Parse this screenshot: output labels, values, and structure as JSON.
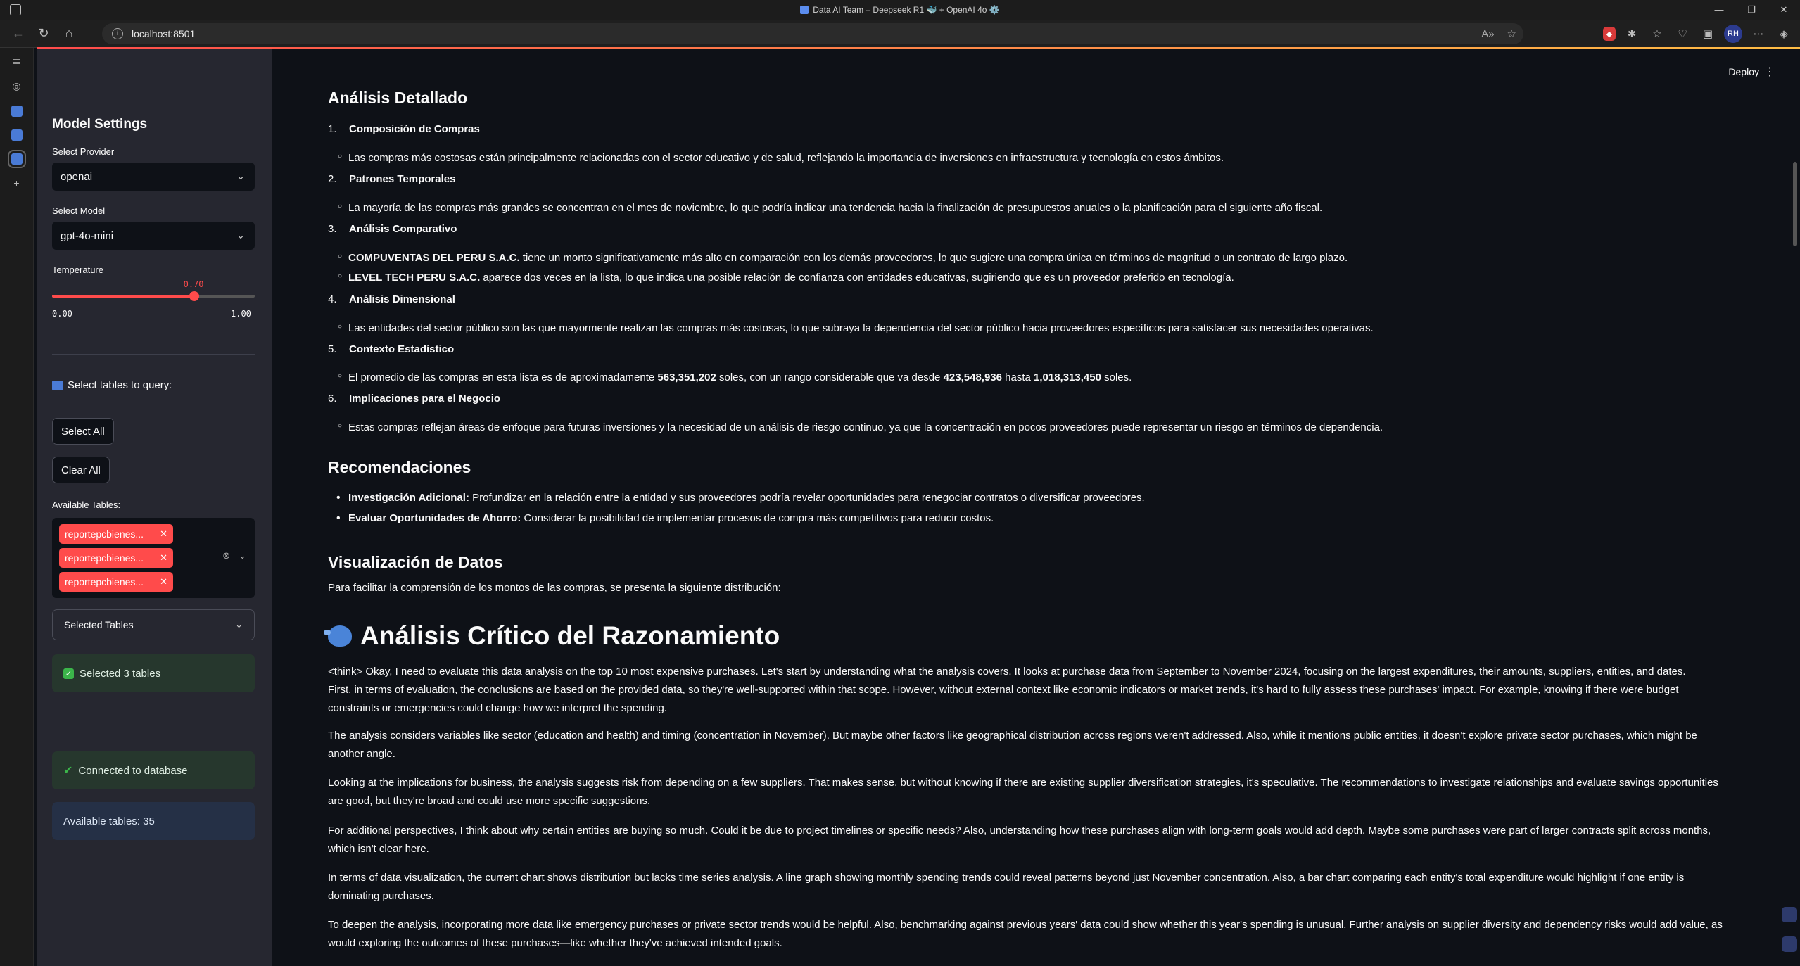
{
  "browser": {
    "window_title": "Data AI Team – Deepseek R1 🐳 + OpenAI 4o ⚙️",
    "url": "localhost:8501",
    "avatar_initials": "RH"
  },
  "sidebar": {
    "title": "Model Settings",
    "provider_label": "Select Provider",
    "provider_value": "openai",
    "model_label": "Select Model",
    "model_value": "gpt-4o-mini",
    "temperature_label": "Temperature",
    "temperature_value": "0.70",
    "temperature_fraction": 0.7,
    "temperature_min": "0.00",
    "temperature_max": "1.00",
    "tables_heading": "Select tables to query:",
    "select_all": "Select All",
    "clear_all": "Clear All",
    "available_label": "Available Tables:",
    "selected_tags": [
      "reportepcbienes...",
      "reportepcbienes...",
      "reportepcbienes..."
    ],
    "selected_tables_expander": "Selected Tables",
    "selected_count_msg": "Selected 3 tables",
    "connected_msg": "Connected to database",
    "available_count_msg": "Available tables: 35"
  },
  "main": {
    "deploy": "Deploy",
    "analysis_title": "Análisis Detallado",
    "numbered": [
      {
        "num": "1.",
        "title": "Composición de Compras"
      },
      {
        "num": "2.",
        "title": "Patrones Temporales"
      },
      {
        "num": "3.",
        "title": "Análisis Comparativo"
      },
      {
        "num": "4.",
        "title": "Análisis Dimensional"
      },
      {
        "num": "5.",
        "title": "Contexto Estadístico"
      },
      {
        "num": "6.",
        "title": "Implicaciones para el Negocio"
      }
    ],
    "b1": "Las compras más costosas están principalmente relacionadas con el sector educativo y de salud, reflejando la importancia de inversiones en infraestructura y tecnología en estos ámbitos.",
    "b2": "La mayoría de las compras más grandes se concentran en el mes de noviembre, lo que podría indicar una tendencia hacia la finalización de presupuestos anuales o la planificación para el siguiente año fiscal.",
    "b3a_bold": "COMPUVENTAS DEL PERU S.A.C.",
    "b3a": " tiene un monto significativamente más alto en comparación con los demás proveedores, lo que sugiere una compra única en términos de magnitud o un contrato de largo plazo.",
    "b3b_bold": "LEVEL TECH PERU S.A.C.",
    "b3b": " aparece dos veces en la lista, lo que indica una posible relación de confianza con entidades educativas, sugiriendo que es un proveedor preferido en tecnología.",
    "b4": "Las entidades del sector público son las que mayormente realizan las compras más costosas, lo que subraya la dependencia del sector público hacia proveedores específicos para satisfacer sus necesidades operativas.",
    "b5_pre": "El promedio de las compras en esta lista es de aproximadamente ",
    "b5_avg": "563,351,202",
    "b5_mid": " soles, con un rango considerable que va desde ",
    "b5_min": "423,548,936",
    "b5_hasta": " hasta ",
    "b5_max": "1,018,313,450",
    "b5_end": " soles.",
    "b6": "Estas compras reflejan áreas de enfoque para futuras inversiones y la necesidad de un análisis de riesgo continuo, ya que la concentración en pocos proveedores puede representar un riesgo en términos de dependencia.",
    "rec_title": "Recomendaciones",
    "rec1_bold": "Investigación Adicional:",
    "rec1": " Profundizar en la relación entre la entidad y sus proveedores podría revelar oportunidades para renegociar contratos o diversificar proveedores.",
    "rec2_bold": "Evaluar Oportunidades de Ahorro:",
    "rec2": " Considerar la posibilidad de implementar procesos de compra más competitivos para reducir costos.",
    "viz_title": "Visualización de Datos",
    "viz_text": "Para facilitar la comprensión de los montos de las compras, se presenta la siguiente distribución:",
    "critique_title": "Análisis Crítico del Razonamiento",
    "p1": "<think> Okay, I need to evaluate this data analysis on the top 10 most expensive purchases. Let's start by understanding what the analysis covers. It looks at purchase data from September to November 2024, focusing on the largest expenditures, their amounts, suppliers, entities, and dates.",
    "p1b": "First, in terms of evaluation, the conclusions are based on the provided data, so they're well-supported within that scope. However, without external context like economic indicators or market trends, it's hard to fully assess these purchases' impact. For example, knowing if there were budget constraints or emergencies could change how we interpret the spending.",
    "p2": "The analysis considers variables like sector (education and health) and timing (concentration in November). But maybe other factors like geographical distribution across regions weren't addressed. Also, while it mentions public entities, it doesn't explore private sector purchases, which might be another angle.",
    "p3": "Looking at the implications for business, the analysis suggests risk from depending on a few suppliers. That makes sense, but without knowing if there are existing supplier diversification strategies, it's speculative. The recommendations to investigate relationships and evaluate savings opportunities are good, but they're broad and could use more specific suggestions.",
    "p4": "For additional perspectives, I think about why certain entities are buying so much. Could it be due to project timelines or specific needs? Also, understanding how these purchases align with long-term goals would add depth. Maybe some purchases were part of larger contracts split across months, which isn't clear here.",
    "p5": "In terms of data visualization, the current chart shows distribution but lacks time series analysis. A line graph showing monthly spending trends could reveal patterns beyond just November concentration. Also, a bar chart comparing each entity's total expenditure would highlight if one entity is dominating purchases.",
    "p6": "To deepen the analysis, incorporating more data like emergency purchases or private sector trends would be helpful. Also, benchmarking against previous years' data could show whether this year's spending is unusual. Further analysis on supplier diversity and dependency risks would add value, as would exploring the outcomes of these purchases—like whether they've achieved intended goals."
  }
}
